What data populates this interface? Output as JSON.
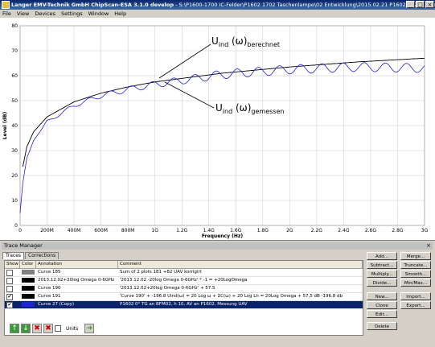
{
  "window": {
    "title": "Langer EMV-Technik GmbH ChipScan-ESA 3.1.0 develop",
    "path": "S:\\P1600-1700 IC-Felder\\P1602 1702 Taschenlampe\\02 Entwicklung\\2015.02.21 P1602 P1702 Benutzerhandbuch\\2015.03.1..."
  },
  "menu": [
    "File",
    "View",
    "Devices",
    "Settings",
    "Window",
    "Help"
  ],
  "chart_data": {
    "type": "line",
    "xlabel": "Frequency (Hz)",
    "ylabel": "Level (dB)",
    "xlim": [
      0,
      3000000000
    ],
    "ylim": [
      0,
      80
    ],
    "x_ticks": [
      "0",
      "200M",
      "400M",
      "600M",
      "800M",
      "1G",
      "1.2G",
      "1.4G",
      "1.6G",
      "1.8G",
      "2G",
      "2.2G",
      "2.4G",
      "2.6G",
      "2.8G",
      "3G"
    ],
    "y_ticks": [
      "0",
      "10",
      "20",
      "30",
      "40",
      "50",
      "60",
      "70",
      "80"
    ],
    "series": [
      {
        "name": "U_ind (ω)_berechnet",
        "color": "#000000",
        "x": [
          20000000,
          50000000,
          100000000,
          200000000,
          400000000,
          600000000,
          800000000,
          1000000000,
          1500000000,
          2000000000,
          2500000000,
          3000000000
        ],
        "y": [
          23.5,
          31.5,
          37.5,
          43.5,
          49.5,
          53,
          55.5,
          57.5,
          61,
          63.5,
          65.5,
          67
        ]
      },
      {
        "name": "U_ind (ω)_gemessen",
        "color": "#2020e0",
        "x": [
          20000000,
          50000000,
          100000000,
          200000000,
          400000000,
          600000000,
          800000000,
          1000000000,
          1500000000,
          2000000000,
          2500000000,
          3000000000
        ],
        "y": [
          17,
          27,
          34,
          41.5,
          48,
          52,
          54.5,
          56.5,
          60.5,
          62.5,
          63.5,
          63
        ]
      }
    ],
    "annotations": [
      {
        "main": "U",
        "sub1": "ind",
        "mid": " (ω)",
        "sub2": "berechnet"
      },
      {
        "main": "U",
        "sub1": "ind",
        "mid": " (ω)",
        "sub2": "gemessen"
      }
    ],
    "grid": true
  },
  "trace_manager": {
    "title": "Trace Manager",
    "tabs": [
      "Traces",
      "Corrections"
    ],
    "columns": [
      "Show",
      "Color",
      "Annotation",
      "Comment"
    ],
    "rows": [
      {
        "show": false,
        "color": "#808080",
        "annotation": "Curve 185",
        "comment": "Sum of 2 plots  181 +82 UAV korrigirt",
        "selected": false
      },
      {
        "show": false,
        "color": "#000000",
        "annotation": "2013.12.02+20log Omega 0-6GHz",
        "comment": "'2013.12.02 -20log Omega 0-6GHz' * -1 = +20LogOmega",
        "selected": false
      },
      {
        "show": false,
        "color": "#000000",
        "annotation": "Curve 190",
        "comment": "'2013.12.02+20log Omega 0-6GHz' + 57.5",
        "selected": false
      },
      {
        "show": true,
        "color": "#000000",
        "annotation": "Curve 191",
        "comment": "'Curve 190' + -196.8                          Uind(ω) = 20 Log ω + ΣC(ω) + 20 Log Lh   = 20Log Omega + 57,5 dB -196,8 db",
        "selected": false
      },
      {
        "show": true,
        "color": "#2020e0",
        "annotation": "Curve 27 (Copy)",
        "comment": "P1602    0°    TG an BFM02,   h 10, AV an P1602,                      Messung UAV",
        "selected": true
      }
    ],
    "buttons_mid": [
      "Add...",
      "Subtract...",
      "Multiply...",
      "Divide...",
      "New...",
      "Clone",
      "Edit...",
      "Delete"
    ],
    "buttons_right": [
      "Merge...",
      "Truncate...",
      "Smooth...",
      "Min/Max...",
      "Import...",
      "Export..."
    ],
    "units_label": "Units"
  }
}
